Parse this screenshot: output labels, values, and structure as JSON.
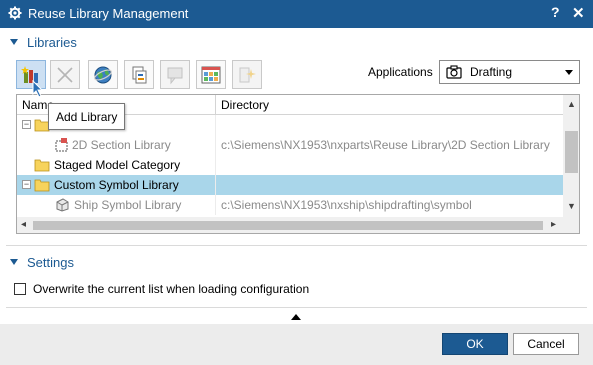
{
  "window": {
    "title": "Reuse Library Management",
    "help_label": "?",
    "close_label": "✕",
    "titlebar_color": "#1c5a92"
  },
  "libraries_section": {
    "header": "Libraries",
    "toolbar": [
      {
        "name": "add-library",
        "icon": "add-library-icon",
        "state": "active"
      },
      {
        "name": "remove",
        "icon": "delete-x-icon",
        "state": "disabled"
      },
      {
        "name": "web-library",
        "icon": "globe-icon",
        "state": "enabled"
      },
      {
        "name": "link-library",
        "icon": "chain-link-icon",
        "state": "enabled"
      },
      {
        "name": "edit-properties",
        "icon": "properties-icon",
        "state": "disabled"
      },
      {
        "name": "palette-view",
        "icon": "palette-grid-icon",
        "state": "enabled"
      },
      {
        "name": "reload",
        "icon": "reload-star-icon",
        "state": "disabled"
      }
    ],
    "tooltip": "Add Library",
    "applications_label": "Applications",
    "applications_value": "Drafting",
    "applications_icon": "drafting-camera-icon",
    "tree": {
      "columns": [
        "Name",
        "Directory"
      ],
      "rows": [
        {
          "name": "",
          "directory": "",
          "icon": "folder-icon",
          "expander": "−",
          "dim": false,
          "selected": false
        },
        {
          "name": "2D Section Library",
          "directory": "c:\\Siemens\\NX1953\\nxparts\\Reuse Library\\2D Section Library",
          "icon": "section-library-icon",
          "expander": "",
          "dim": true,
          "selected": false
        },
        {
          "name": "Staged Model Category",
          "directory": "",
          "icon": "folder-icon",
          "expander": "",
          "dim": false,
          "selected": false
        },
        {
          "name": "Custom Symbol Library",
          "directory": "",
          "icon": "folder-icon",
          "expander": "−",
          "dim": false,
          "selected": true
        },
        {
          "name": "Ship Symbol Library",
          "directory": "c:\\Siemens\\NX1953\\nxship\\shipdrafting\\symbol",
          "icon": "symbol-library-icon",
          "expander": "",
          "dim": true,
          "selected": false
        }
      ]
    }
  },
  "settings_section": {
    "header": "Settings",
    "overwrite_label": "Overwrite the current list when loading configuration",
    "overwrite_checked": false
  },
  "footer": {
    "ok_label": "OK",
    "cancel_label": "Cancel"
  }
}
